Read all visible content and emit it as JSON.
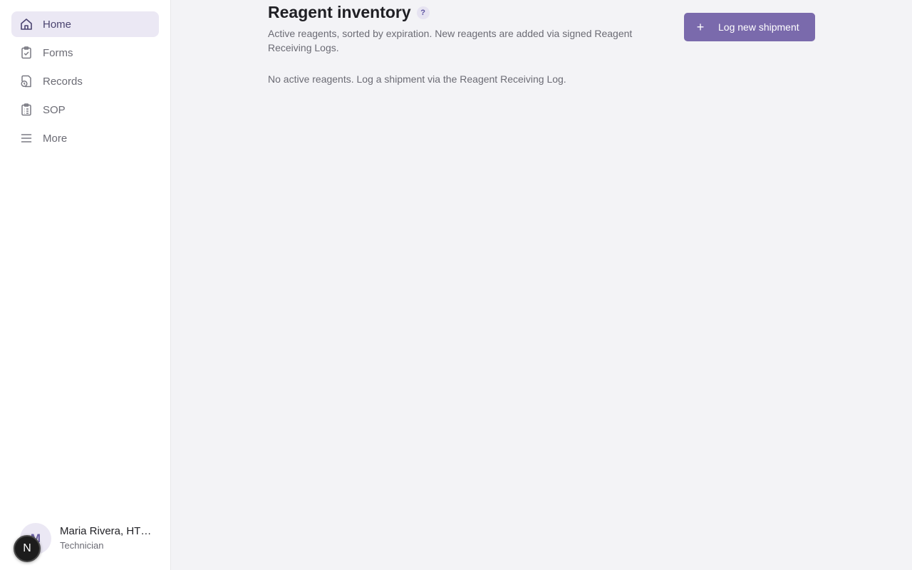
{
  "sidebar": {
    "items": [
      {
        "label": "Home",
        "icon": "home-icon",
        "active": true
      },
      {
        "label": "Forms",
        "icon": "clipboard-check-icon",
        "active": false
      },
      {
        "label": "Records",
        "icon": "file-clock-icon",
        "active": false
      },
      {
        "label": "SOP",
        "icon": "clipboard-list-icon",
        "active": false
      },
      {
        "label": "More",
        "icon": "menu-icon",
        "active": false
      }
    ],
    "user": {
      "initials": "M",
      "name": "Maria Rivera, HT…",
      "role": "Technician",
      "dev_badge": "N"
    }
  },
  "main": {
    "title": "Reagent inventory",
    "help_label": "?",
    "description": "Active reagents, sorted by expiration. New reagents are added via signed Reagent Receiving Logs.",
    "empty_message": "No active reagents. Log a shipment via the Reagent Receiving Log.",
    "primary_button": {
      "icon": "plus-icon",
      "symbol": "+",
      "label": "Log new shipment"
    }
  },
  "colors": {
    "accent": "#7a6aac",
    "active_nav_bg": "#ebe8f4",
    "page_bg": "#f3f3f6",
    "sidebar_bg": "#ffffff"
  }
}
